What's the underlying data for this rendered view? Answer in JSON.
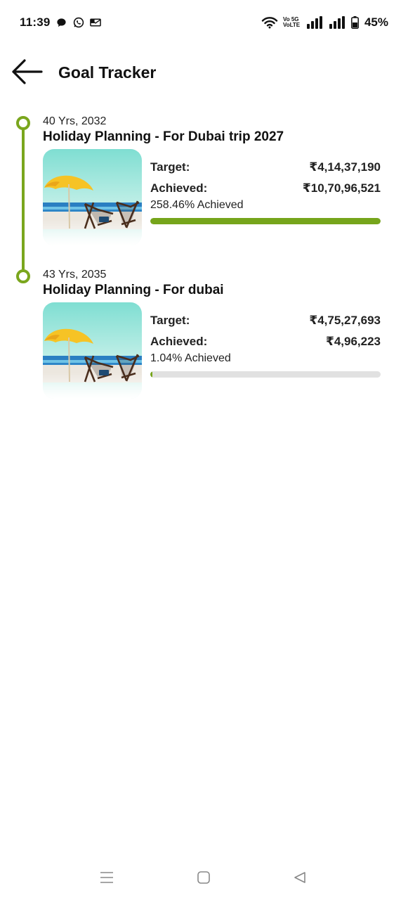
{
  "status_bar": {
    "time": "11:39",
    "notification_icons": [
      "chat-bubble-icon",
      "whatsapp-icon",
      "email-icon"
    ],
    "network_label": "Vo 5G\nVoLTE",
    "network_line1": "Vo 5G",
    "network_line2": "VoLTE",
    "battery_percent": "45%"
  },
  "header": {
    "title": "Goal Tracker",
    "back_icon": "arrow-left-icon"
  },
  "colors": {
    "accent": "#7aa61d",
    "track": "#e1e1e1"
  },
  "goals": [
    {
      "meta": "40 Yrs, 2032",
      "title": "Holiday Planning - For Dubai trip 2027",
      "target_label": "Target:",
      "target_value": "₹4,14,37,190",
      "achieved_label": "Achieved:",
      "achieved_value": "₹10,70,96,521",
      "percent_text": "258.46% Achieved",
      "progress": 1.0
    },
    {
      "meta": "43 Yrs, 2035",
      "title": "Holiday Planning - For dubai",
      "target_label": "Target:",
      "target_value": "₹4,75,27,693",
      "achieved_label": "Achieved:",
      "achieved_value": "₹4,96,223",
      "percent_text": "1.04% Achieved",
      "progress": 0.0104
    }
  ],
  "nav_bar": {
    "icons": [
      "menu-icon",
      "home-square-icon",
      "back-triangle-icon"
    ]
  }
}
